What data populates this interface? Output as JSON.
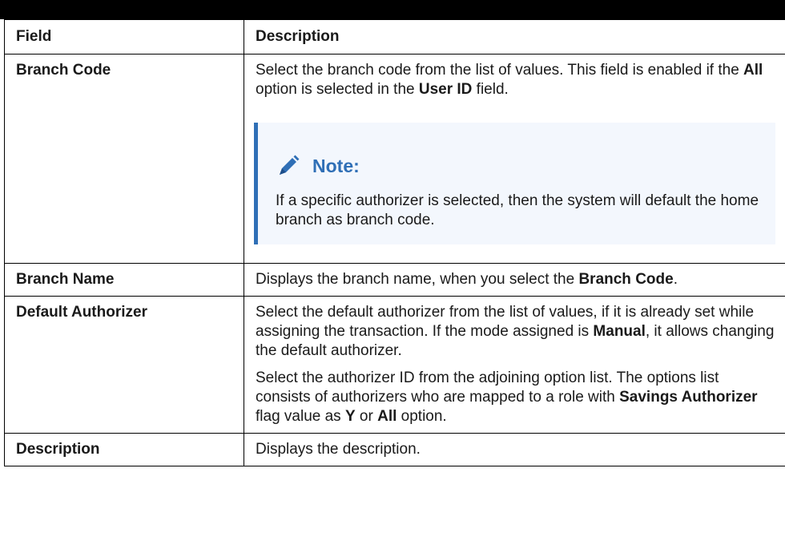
{
  "header": {
    "field": "Field",
    "description": "Description"
  },
  "rows": [
    {
      "field": "Branch Code",
      "p1": [
        "Select the branch code from the list of values. This field is enabled if the ",
        "All",
        " option is selected in the ",
        "User ID",
        " field."
      ],
      "note": {
        "title": "Note:",
        "text": "If a specific authorizer is selected, then the system will default the home branch as branch code."
      }
    },
    {
      "field": "Branch Name",
      "p1": [
        "Displays the branch name, when you select the ",
        "Branch Code",
        "."
      ]
    },
    {
      "field": "Default Authorizer",
      "p1": [
        "Select the default authorizer from the list of values, if it is already set while assigning the transaction. If the mode assigned is ",
        "Manual",
        ", it allows changing the default authorizer."
      ],
      "p2": [
        "Select the authorizer ID from the adjoining option list. The options list consists of authorizers who are mapped to a role with ",
        "Savings Authorizer",
        " flag value as ",
        "Y",
        " or ",
        "All",
        " option."
      ]
    },
    {
      "field": "Description",
      "p1": [
        "Displays the description."
      ]
    }
  ]
}
